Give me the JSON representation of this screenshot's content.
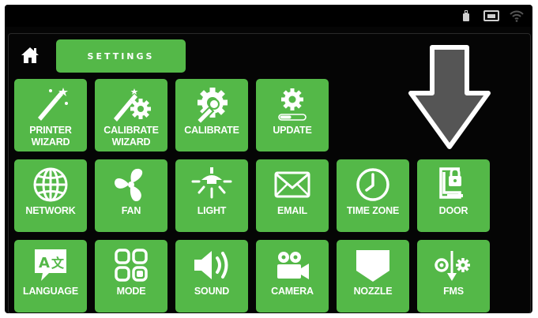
{
  "header": {
    "title": "SETTINGS"
  },
  "status_icons": [
    "usb-icon",
    "ethernet-icon",
    "wifi-icon"
  ],
  "colors": {
    "tile": "#54b848",
    "background": "#050505",
    "arrow": "#555555",
    "icon": "#ffffff"
  },
  "tiles": [
    {
      "name": "printer-wizard",
      "label": "PRINTER\nWIZARD",
      "icon": "wand-icon"
    },
    {
      "name": "calibrate-wizard",
      "label": "CALIBRATE\nWIZARD",
      "icon": "wand-gear-icon"
    },
    {
      "name": "calibrate",
      "label": "CALIBRATE",
      "icon": "wrench-gear-icon"
    },
    {
      "name": "update",
      "label": "UPDATE",
      "icon": "gear-progress-icon"
    },
    {
      "name": "network",
      "label": "NETWORK",
      "icon": "globe-icon"
    },
    {
      "name": "fan",
      "label": "FAN",
      "icon": "fan-icon"
    },
    {
      "name": "light",
      "label": "LIGHT",
      "icon": "lamp-icon"
    },
    {
      "name": "email",
      "label": "EMAIL",
      "icon": "envelope-icon"
    },
    {
      "name": "time-zone",
      "label": "TIME ZONE",
      "icon": "clock-icon"
    },
    {
      "name": "door",
      "label": "DOOR",
      "icon": "door-lock-icon"
    },
    {
      "name": "language",
      "label": "LANGUAGE",
      "icon": "language-icon"
    },
    {
      "name": "mode",
      "label": "MODE",
      "icon": "mode-grid-icon"
    },
    {
      "name": "sound",
      "label": "SOUND",
      "icon": "speaker-icon"
    },
    {
      "name": "camera",
      "label": "CAMERA",
      "icon": "camera-icon"
    },
    {
      "name": "nozzle",
      "label": "NOZZLE",
      "icon": "nozzle-icon"
    },
    {
      "name": "fms",
      "label": "FMS",
      "icon": "fms-icon"
    }
  ]
}
